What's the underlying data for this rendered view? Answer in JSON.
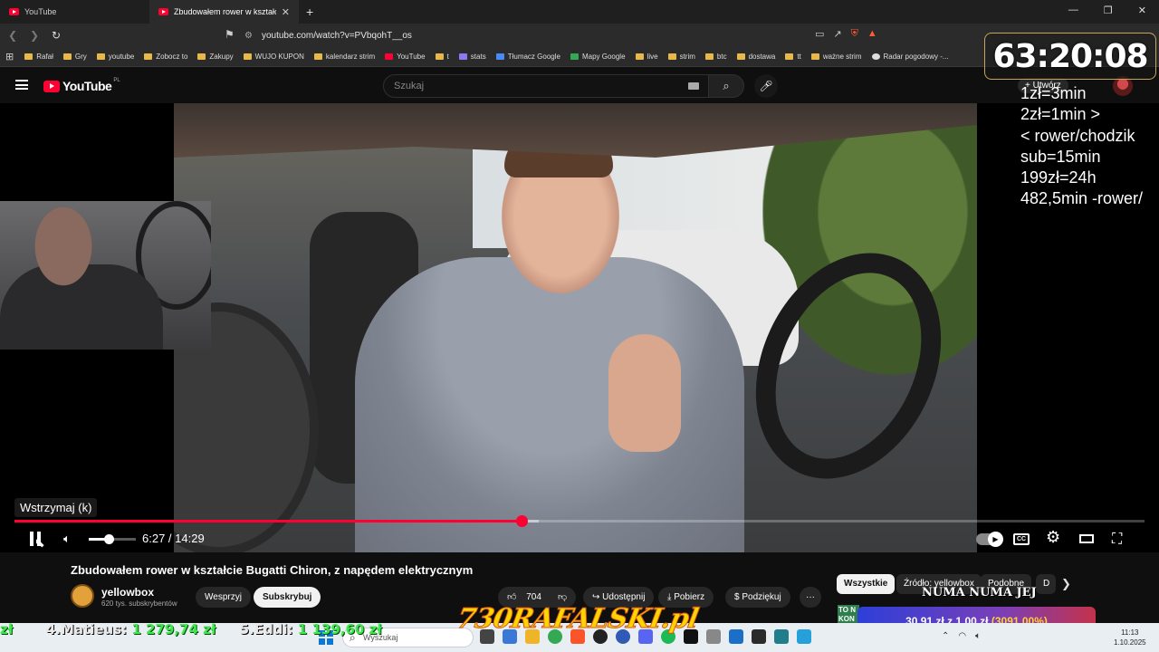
{
  "browser": {
    "tabs": [
      {
        "title": "YouTube",
        "active": false
      },
      {
        "title": "Zbudowałem rower w kształcie Bugatti",
        "active": true
      }
    ],
    "url": "youtube.com/watch?v=PVbqohT__os",
    "bookmarks": [
      "Rafał",
      "Gry",
      "youtube",
      "Zobocz to",
      "Zakupy",
      "WUJO KUPON",
      "kalendarz strim",
      "YouTube",
      "t",
      "stats",
      "Tłumacz Google",
      "Mapy Google",
      "live",
      "strim",
      "btc",
      "dostawa",
      "tt",
      "ważne strim",
      "Radar pogodowy -..."
    ]
  },
  "youtube": {
    "logo": "YouTube",
    "region": "PL",
    "search_placeholder": "Szukaj",
    "create_label": "Utwórz"
  },
  "stream": {
    "timer": "63:20:08",
    "rules": [
      "1zł=3min",
      "2zł=1min >",
      "< rower/chodzik",
      "sub=15min",
      "199zł=24h",
      "482,5min -rower/"
    ],
    "ticker": {
      "entries": [
        {
          "label": "zł",
          "value": ""
        },
        {
          "label": "4.Matieus:",
          "value": "1 279,74 zł"
        },
        {
          "label": "5.Eddi:",
          "value": "1 139,60 zł"
        }
      ]
    },
    "brand": "730RAFALSKI.pl",
    "banner": "NUMA NUMA JEJ",
    "donation": {
      "main": "30,91 zł z 1,00 zł",
      "pct": "(3091.00%)"
    },
    "promo": "TO N KON"
  },
  "player": {
    "tooltip": "Wstrzymaj (k)",
    "current_time": "6:27",
    "duration": "14:29",
    "time_display": "6:27 / 14:29",
    "played_fraction": 0.449,
    "buffered_fraction": 0.464,
    "volume_fraction": 0.42
  },
  "video": {
    "title": "Zbudowałem rower w kształcie Bugatti Chiron, z napędem elektrycznym",
    "channel": "yellowbox",
    "subscribers": "620 tys. subskrybentów",
    "join_label": "Wesprzyj",
    "subscribe_label": "Subskrybuj",
    "likes": "704",
    "share_label": "Udostępnij",
    "download_label": "Pobierz",
    "thanks_label": "Podziękuj",
    "more_label": "···"
  },
  "related_chips": [
    "Wszystkie",
    "Źródło: yellowbox",
    "Podobne",
    "D"
  ],
  "taskbar": {
    "search_placeholder": "Wyszukaj",
    "time": "11:13",
    "date": "1.10.2025"
  }
}
